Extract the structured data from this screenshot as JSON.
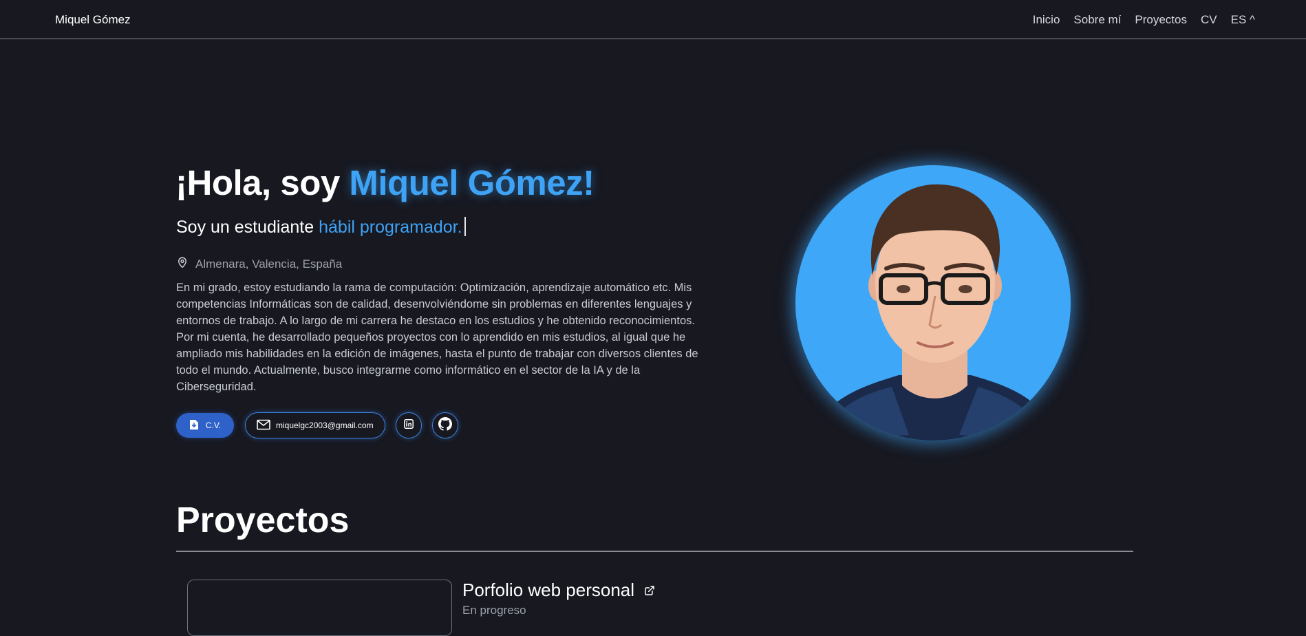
{
  "nav": {
    "brand": "Miquel Gómez",
    "links": [
      "Inicio",
      "Sobre mí",
      "Proyectos",
      "CV",
      "ES ^"
    ]
  },
  "hero": {
    "greeting": "¡Hola, soy",
    "name": "Miquel Gómez!",
    "subtitle_prefix": "Soy un estudiante",
    "subtitle_typed": "hábil programador.",
    "location": "Almenara, Valencia, España",
    "bio": "En mi grado, estoy estudiando la rama de computación: Optimización, aprendizaje automático etc. Mis competencias Informáticas son de calidad, desenvolviéndome sin problemas en diferentes lenguajes y entornos de trabajo. A lo largo de mi carrera he destaco en los estudios y he obtenido reconocimientos. Por mi cuenta, he desarrollado pequeños proyectos con lo aprendido en mis estudios, al igual que he ampliado mis habilidades en la edición de imágenes, hasta el punto de trabajar con diversos clientes de todo el mundo. Actualmente, busco integrarme como informático en el sector de la IA y de la Ciberseguridad.",
    "cv_button": "C.V.",
    "email_button": "miquelgc2003@gmail.com"
  },
  "projects": {
    "heading": "Proyectos",
    "items": [
      {
        "title": "Porfolio web personal",
        "status": "En progreso"
      }
    ]
  },
  "colors": {
    "background": "#171820",
    "accent": "#3ea2f5",
    "button_primary": "#2f62c8"
  },
  "icons": [
    "map-pin-icon",
    "file-download-icon",
    "mail-icon",
    "linkedin-icon",
    "github-icon",
    "external-link-icon"
  ]
}
